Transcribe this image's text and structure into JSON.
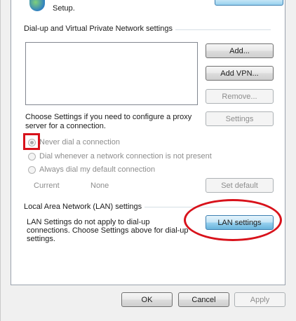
{
  "top": {
    "setup_text": "Setup."
  },
  "dialup": {
    "section_label": "Dial-up and Virtual Private Network settings",
    "add_label": "Add...",
    "add_vpn_label": "Add VPN...",
    "remove_label": "Remove...",
    "proxy_text": "Choose Settings if you need to configure a proxy server for a connection.",
    "settings_label": "Settings",
    "radios": [
      {
        "label": "Never dial a connection",
        "checked": true
      },
      {
        "label": "Dial whenever a network connection is not present",
        "checked": false
      },
      {
        "label": "Always dial my default connection",
        "checked": false
      }
    ],
    "current_label": "Current",
    "current_value": "None",
    "set_default_label": "Set default"
  },
  "lan": {
    "section_label": "Local Area Network (LAN) settings",
    "info_text": "LAN Settings do not apply to dial-up connections. Choose Settings above for dial-up settings.",
    "lan_settings_label": "LAN settings"
  },
  "footer": {
    "ok_label": "OK",
    "cancel_label": "Cancel",
    "apply_label": "Apply"
  },
  "colors": {
    "annotation_red": "#d8121b",
    "focus_blue": "#3c7fb1"
  }
}
